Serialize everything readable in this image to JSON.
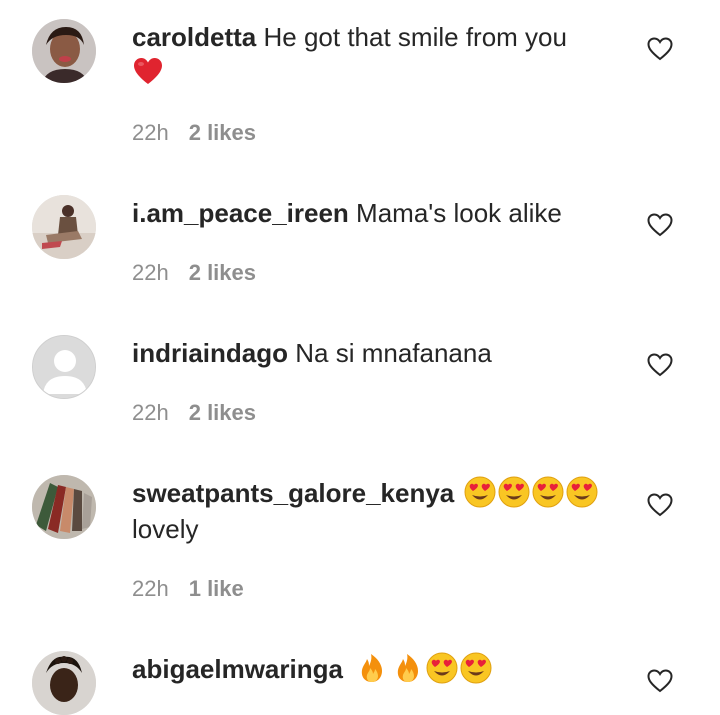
{
  "comments": [
    {
      "username": "caroldetta",
      "text": "He got that smile from you",
      "emojis": [
        "red-heart"
      ],
      "time": "22h",
      "likes": "2 likes",
      "avatar": "photo-woman"
    },
    {
      "username": "i.am_peace_ireen",
      "text": "Mama's look alike",
      "emojis": [],
      "time": "22h",
      "likes": "2 likes",
      "avatar": "photo-person-sitting"
    },
    {
      "username": "indriaindago",
      "text": "Na si mnafanana",
      "emojis": [],
      "time": "22h",
      "likes": "2 likes",
      "avatar": "default-avatar"
    },
    {
      "username": "sweatpants_galore_kenya",
      "text": "lovely",
      "emojis": [
        "heart-eyes",
        "heart-eyes",
        "heart-eyes",
        "heart-eyes"
      ],
      "time": "22h",
      "likes": "1 like",
      "avatar": "photo-clothes"
    },
    {
      "username": "abigaelmwaringa",
      "text": "",
      "emojis": [
        "fire",
        "fire",
        "heart-eyes",
        "heart-eyes"
      ],
      "time": "",
      "likes": "",
      "avatar": "photo-person"
    }
  ],
  "colors": {
    "text": "#262626",
    "meta": "#8e8e8e",
    "heart_outline": "#262626",
    "red_heart": "#e0242f"
  }
}
